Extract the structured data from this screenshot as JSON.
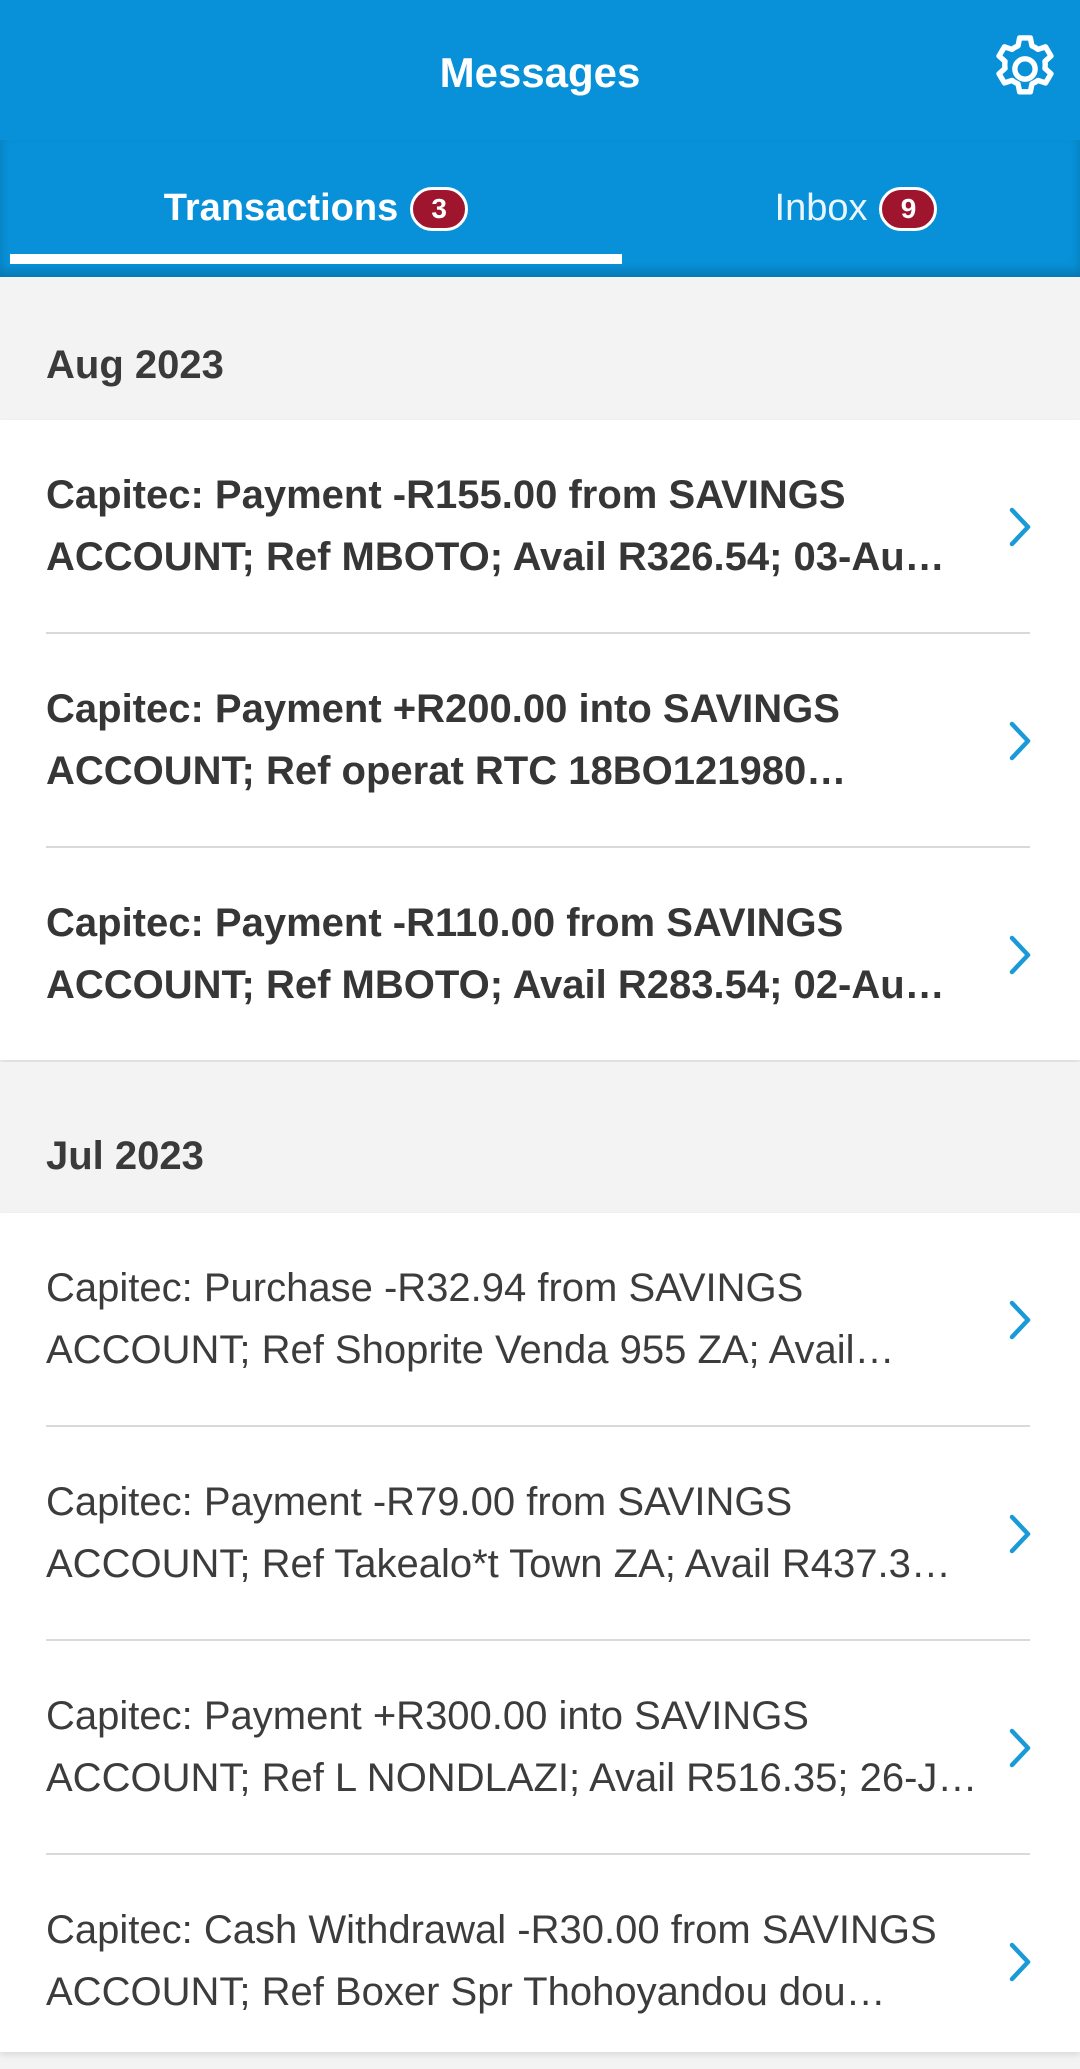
{
  "header": {
    "title": "Messages",
    "settings_icon": "gear-icon"
  },
  "tabs": [
    {
      "label": "Transactions",
      "badge": "3",
      "selected": true
    },
    {
      "label": "Inbox",
      "badge": "9",
      "selected": false
    }
  ],
  "sections": [
    {
      "title": "Aug 2023",
      "messages": [
        {
          "text": "Capitec: Payment -R155.00 from SAVINGS ACCOUNT; Ref MBOTO; Avail R326.54; 03-Au…",
          "unread": true
        },
        {
          "text": "Capitec: Payment +R200.00 into SAVINGS ACCOUNT; Ref operat RTC 18BO121980…",
          "unread": true
        },
        {
          "text": "Capitec: Payment -R110.00 from SAVINGS ACCOUNT; Ref MBOTO; Avail R283.54; 02-Au…",
          "unread": true
        }
      ]
    },
    {
      "title": "Jul 2023",
      "messages": [
        {
          "text": "Capitec: Purchase -R32.94 from SAVINGS ACCOUNT; Ref Shoprite Venda 955 ZA; Avail…",
          "unread": false
        },
        {
          "text": "Capitec: Payment -R79.00 from SAVINGS ACCOUNT; Ref Takealo*t Town ZA; Avail R437.3…",
          "unread": false
        },
        {
          "text": "Capitec: Payment +R300.00 into SAVINGS ACCOUNT; Ref L NONDLAZI; Avail R516.35; 26-J…",
          "unread": false
        },
        {
          "text": "Capitec: Cash Withdrawal -R30.00 from SAVINGS ACCOUNT; Ref Boxer Spr Thohoyandou dou…",
          "unread": false
        }
      ]
    }
  ],
  "colors": {
    "primary": "#0891d8",
    "badge": "#a0152e",
    "chevron": "#1a9ad6",
    "background": "#f3f3f3"
  }
}
